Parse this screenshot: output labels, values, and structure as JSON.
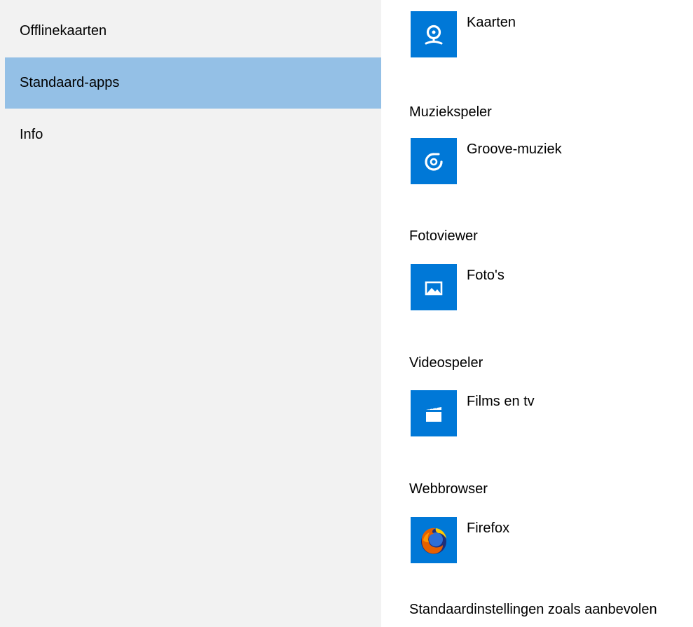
{
  "sidebar": {
    "items": [
      {
        "label": "Offlinekaarten",
        "selected": false
      },
      {
        "label": "Standaard-apps",
        "selected": true
      },
      {
        "label": "Info",
        "selected": false
      }
    ]
  },
  "defaults": {
    "maps": {
      "app": "Kaarten",
      "icon": "maps-icon"
    },
    "music": {
      "category": "Muziekspeler",
      "app": "Groove-muziek",
      "icon": "groove-music-icon"
    },
    "photos": {
      "category": "Fotoviewer",
      "app": "Foto's",
      "icon": "photos-icon"
    },
    "video": {
      "category": "Videospeler",
      "app": "Films en tv",
      "icon": "films-tv-icon"
    },
    "browser": {
      "category": "Webbrowser",
      "app": "Firefox",
      "icon": "firefox-icon"
    },
    "reset_label": "Standaardinstellingen zoals aanbevolen"
  },
  "colors": {
    "sidebar_bg": "#f2f2f2",
    "selected_bg": "#94c0e6",
    "tile_blue": "#0078d7"
  }
}
